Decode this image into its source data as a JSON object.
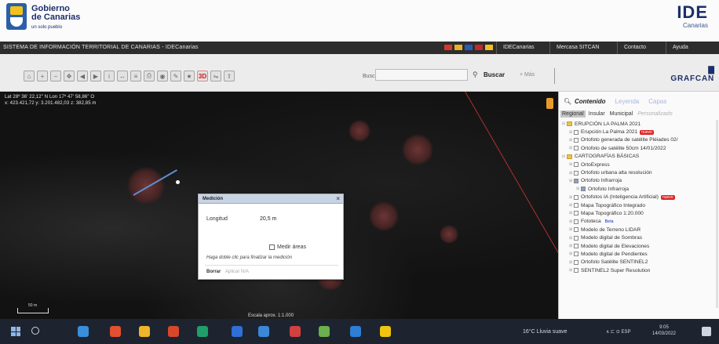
{
  "header": {
    "brand_line1": "Gobierno",
    "brand_line2": "de Canarias",
    "brand_tagline": "un solo pueblo",
    "ide_logo_title": "IDE",
    "ide_logo_sub": "Canarias"
  },
  "navbar": {
    "title": "SISTEMA DE INFORMACIÓN TERRITORIAL DE CANARIAS - IDECanarias",
    "flags": [
      "#d8372b",
      "#e9b02a",
      "#2b59b5",
      "#c12a2a",
      "#f0c023"
    ],
    "links": [
      "IDECanarias",
      "Mercasa SITCAN",
      "Contacto",
      "Ayuda"
    ]
  },
  "toolbar": {
    "tool_icons": [
      "home-icon",
      "zoom-in-icon",
      "zoom-out-icon",
      "pan-icon",
      "previous-view-icon",
      "next-view-icon",
      "info-icon",
      "measure-icon",
      "layers-icon",
      "print-icon",
      "camera-icon",
      "draw-icon",
      "bookmark-icon",
      "3d-icon",
      "compare-icon",
      "share-icon"
    ],
    "tool_3d_label": "3D",
    "search_label": "Buscar",
    "search_placeholder": "",
    "buscar_label": "Buscar",
    "mas_label": "+ Más",
    "grafcan_label": "GRAFCAN"
  },
  "map": {
    "coord_line1": "Lat 28º 36' 22,12\" N  Lon 17º 47' 58,86\" O",
    "coord_line2": "x: 423.421,72  y: 3.201.482,03  z: 382,85 m",
    "scale_label": "50 m",
    "escala_label": "Escala aprox. 1:1.000",
    "line_color": "#b03030",
    "measure_color": "#5a8fd6"
  },
  "measure_dialog": {
    "title": "Medición",
    "longitud_label": "Longitud",
    "longitud_value": "20,5 m",
    "medir_areas_label": "Medir áreas",
    "hint": "Haga doble clic para finalizar la medición",
    "borrar_label": "Borrar",
    "borrar_sub": "Aplicar N/A"
  },
  "panel": {
    "tabs": [
      "Contenido",
      "Leyenda",
      "Capas"
    ],
    "subtabs": [
      "Regional",
      "Insular",
      "Municipal",
      "Personalizado"
    ],
    "tree": [
      {
        "level": 0,
        "type": "folder",
        "label": "ERUPCIÓN LA PALMA 2021"
      },
      {
        "level": 1,
        "type": "check",
        "label": "Erupción La Palma 2021",
        "badge": "nuevo"
      },
      {
        "level": 1,
        "type": "check",
        "label": "Ortofoto generada de satélite Pléiades 02/"
      },
      {
        "level": 1,
        "type": "check",
        "label": "Ortofoto de satélite 50cm 14/01/2022"
      },
      {
        "level": 0,
        "type": "folder",
        "label": "CARTOGRAFÍAS BÁSICAS"
      },
      {
        "level": 1,
        "type": "check",
        "label": "OrtoExpress"
      },
      {
        "level": 1,
        "type": "check",
        "label": "Ortofoto urbana alta resolución"
      },
      {
        "level": 1,
        "type": "check-on",
        "label": "Ortofoto Infrarroja"
      },
      {
        "level": 2,
        "type": "check-on",
        "label": "Ortofoto Infrarroja"
      },
      {
        "level": 1,
        "type": "check",
        "label": "Ortofotos IA (Inteligencia Artificial)",
        "badge": "nuevo"
      },
      {
        "level": 1,
        "type": "check",
        "label": "Mapa Topográfico Integrado"
      },
      {
        "level": 1,
        "type": "check",
        "label": "Mapa Topográfico 1:20.000"
      },
      {
        "level": 1,
        "type": "check",
        "label": "Fototeca",
        "badge_blue": "Beta"
      },
      {
        "level": 1,
        "type": "check",
        "label": "Modelo de Terreno LIDAR"
      },
      {
        "level": 1,
        "type": "check",
        "label": "Modelo digital de Sombras"
      },
      {
        "level": 1,
        "type": "check",
        "label": "Modelo digital de Elevaciones"
      },
      {
        "level": 1,
        "type": "check",
        "label": "Modelo digital de Pendientes"
      },
      {
        "level": 1,
        "type": "check",
        "label": "Ortofoto Satélite SENTINEL2"
      },
      {
        "level": 1,
        "type": "check",
        "label": "SENTINEL2 Super Resolution"
      }
    ]
  },
  "taskbar": {
    "apps": [
      "#3a8fdc",
      "#e3502f",
      "#f0b429",
      "#d8472b",
      "#1f9e6a",
      "#2f6fd6",
      "#3b88d8",
      "#d24040",
      "#6ab04c",
      "#2c7fd4",
      "#f1c40f"
    ],
    "weather": "16°C  Lluvia suave",
    "tray": "∧  ⊏  ⊙  ESP",
    "time": "9:05",
    "date": "14/03/2022"
  }
}
